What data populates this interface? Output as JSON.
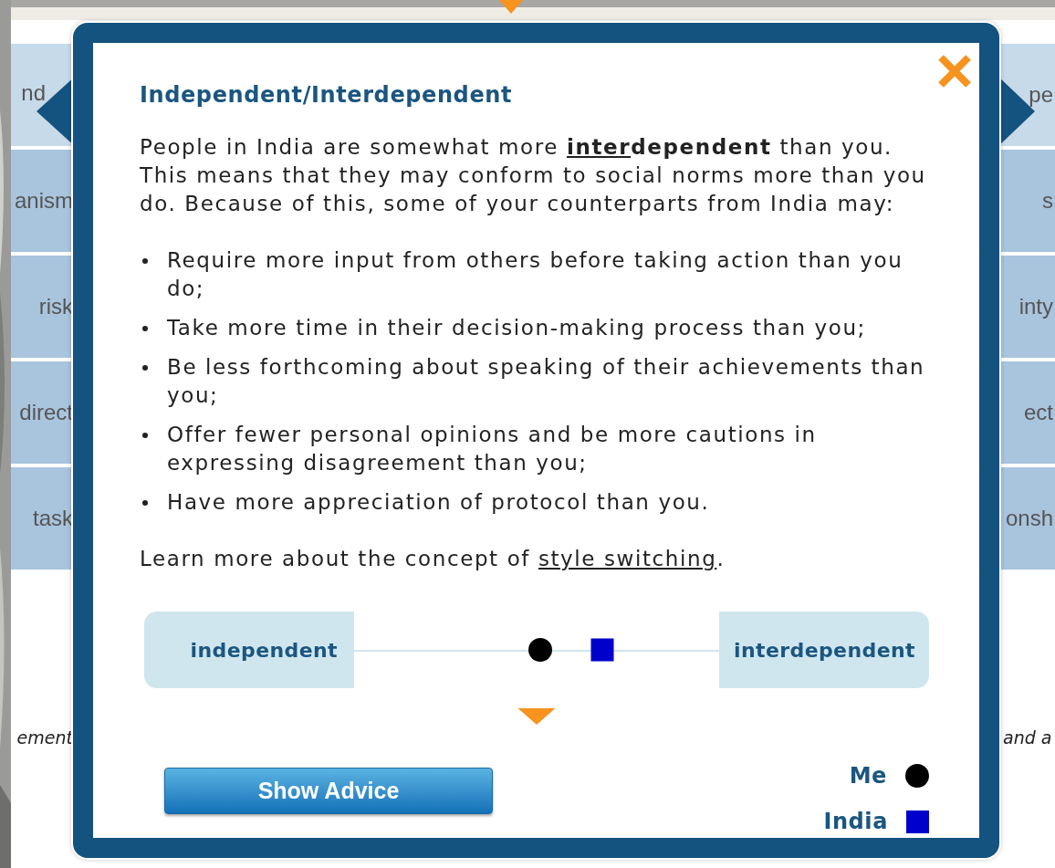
{
  "background": {
    "left_tiles": [
      {
        "label": "nd",
        "selected": true
      },
      {
        "label": "anism",
        "selected": false
      },
      {
        "label": "risk",
        "selected": false
      },
      {
        "label": "direct",
        "selected": false
      },
      {
        "label": "task",
        "selected": false
      }
    ],
    "right_tiles": [
      {
        "label": "pe",
        "selected": true
      },
      {
        "label": "s",
        "selected": false
      },
      {
        "label": "inty",
        "selected": false
      },
      {
        "label": "ect",
        "selected": false
      },
      {
        "label": "onsh",
        "selected": false
      }
    ],
    "left_note": "ement",
    "right_note": "and a"
  },
  "popup": {
    "title": "Independent/Interdependent",
    "intro": {
      "before": "People in India are somewhat more ",
      "emphasis_underlined": "inter",
      "emphasis": "dependent",
      "after": " than you. This means that they may conform to social norms more than you do. Because of this, some of your counterparts from India may:"
    },
    "bullets": [
      "Require more input from others before taking action than you do;",
      "Take more time in their decision-making process than you;",
      "Be less forthcoming about speaking of their achievements than you;",
      "Offer fewer personal opinions and be more cautions in expressing disagreement than you;",
      "Have more appreciation of protocol than you."
    ],
    "learn_more": {
      "before": "Learn more about the concept of ",
      "link": "style switching",
      "after": "."
    },
    "scale": {
      "left_label": "independent",
      "right_label": "interdependent",
      "markers": [
        {
          "kind": "circle",
          "level": 0.51
        },
        {
          "kind": "square",
          "level": 0.68
        }
      ]
    },
    "button": "Show Advice",
    "legend": [
      {
        "label": "Me",
        "kind": "circle"
      },
      {
        "label": "India",
        "kind": "square"
      }
    ]
  }
}
